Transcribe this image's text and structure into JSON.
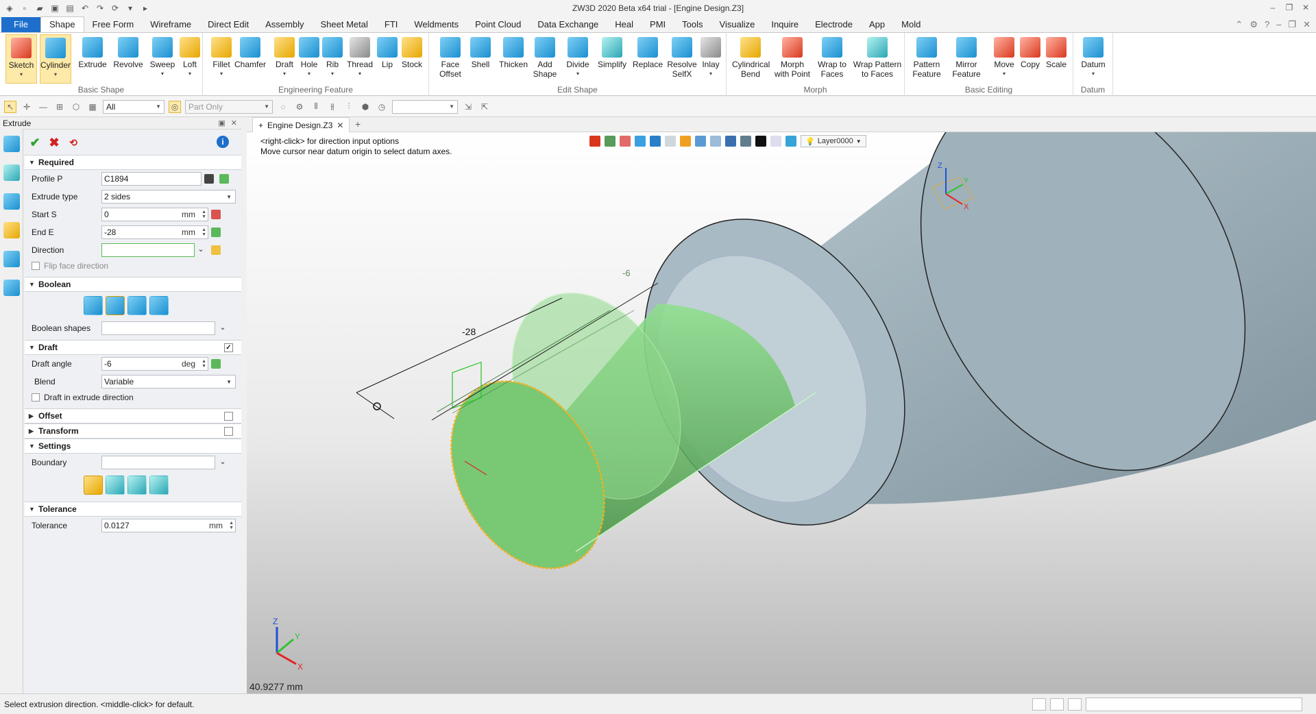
{
  "app": {
    "title": "ZW3D 2020 Beta x64 trial - [Engine Design.Z3]"
  },
  "menu": {
    "items": [
      "File",
      "Shape",
      "Free Form",
      "Wireframe",
      "Direct Edit",
      "Assembly",
      "Sheet Metal",
      "FTI",
      "Weldments",
      "Point Cloud",
      "Data Exchange",
      "Heal",
      "PMI",
      "Tools",
      "Visualize",
      "Inquire",
      "Electrode",
      "App",
      "Mold"
    ],
    "active": "Shape"
  },
  "ribbon": {
    "groups": [
      {
        "label": "Basic Shape",
        "buttons": [
          "Sketch",
          "Cylinder",
          "Extrude",
          "Revolve",
          "Sweep",
          "Loft"
        ]
      },
      {
        "label": "Engineering Feature",
        "buttons": [
          "Fillet",
          "Chamfer",
          "Draft",
          "Hole",
          "Rib",
          "Thread",
          "Lip",
          "Stock"
        ]
      },
      {
        "label": "Edit Shape",
        "buttons": [
          "Face Offset",
          "Shell",
          "Thicken",
          "Add Shape",
          "Divide",
          "Simplify",
          "Replace",
          "Resolve SelfX",
          "Inlay"
        ]
      },
      {
        "label": "Morph",
        "buttons": [
          "Cylindrical Bend",
          "Morph with Point",
          "Wrap to Faces",
          "Wrap Pattern to Faces"
        ]
      },
      {
        "label": "Basic Editing",
        "buttons": [
          "Pattern Feature",
          "Mirror Feature",
          "Move",
          "Copy",
          "Scale"
        ]
      },
      {
        "label": "Datum",
        "buttons": [
          "Datum"
        ]
      }
    ]
  },
  "toolbar2": {
    "filter": "All",
    "scope": "Part Only"
  },
  "panel": {
    "title": "Extrude",
    "sections": {
      "required": "Required",
      "boolean": "Boolean",
      "draft": "Draft",
      "offset": "Offset",
      "transform": "Transform",
      "settings": "Settings",
      "tolerance": "Tolerance"
    },
    "fields": {
      "profile_label": "Profile P",
      "profile_value": "C1894",
      "extrude_type_label": "Extrude type",
      "extrude_type_value": "2 sides",
      "start_label": "Start S",
      "start_value": "0",
      "start_unit": "mm",
      "end_label": "End E",
      "end_value": "-28",
      "end_unit": "mm",
      "direction_label": "Direction",
      "direction_value": "",
      "flip_label": "Flip face direction",
      "boolean_shapes_label": "Boolean shapes",
      "draft_angle_label": "Draft angle",
      "draft_angle_value": "-6",
      "draft_angle_unit": "deg",
      "blend_label": "Blend",
      "blend_value": "Variable",
      "draft_dir_label": "Draft in extrude direction",
      "boundary_label": "Boundary",
      "tolerance_label": "Tolerance",
      "tolerance_value": "0.0127",
      "tolerance_unit": "mm"
    }
  },
  "document": {
    "tab": "Engine Design.Z3"
  },
  "viewport": {
    "hint_line1": "<right-click> for direction input options",
    "hint_line2": "Move cursor near datum origin to select datum axes.",
    "layer": "Layer0000",
    "dim_length": "-28",
    "dim_angle": "-6",
    "measure": "40.9277 mm",
    "axis_z": "Z",
    "axis_y": "Y",
    "axis_x": "X"
  },
  "status": {
    "text": "Select extrusion direction.  <middle-click> for default."
  }
}
